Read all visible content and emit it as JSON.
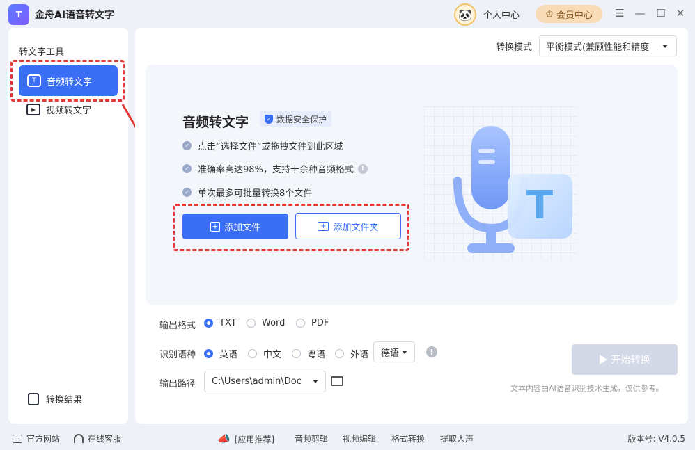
{
  "app": {
    "title": "金舟AI语音转文字",
    "logo_text": "T"
  },
  "header": {
    "personal_center": "个人中心",
    "vip_center": "会员中心",
    "controls": [
      "menu-icon",
      "minimize-icon",
      "maximize-icon",
      "close-icon"
    ]
  },
  "sidebar": {
    "heading": "转文字工具",
    "items": [
      {
        "label": "音频转文字",
        "active": true
      },
      {
        "label": "视频转文字",
        "active": false
      }
    ],
    "result": "转换结果"
  },
  "main": {
    "mode_label": "转换模式",
    "mode_value": "平衡模式(兼顾性能和精度",
    "dropzone": {
      "title": "音频转文字",
      "badge": "数据安全保护",
      "features": [
        "点击“选择文件”或拖拽文件到此区域",
        "准确率高达98%，支持十余种音频格式",
        "单次最多可批量转换8个文件"
      ],
      "add_file": "添加文件",
      "add_folder": "添加文件夹",
      "illustration_letter": "T"
    },
    "output_format": {
      "label": "输出格式",
      "options": [
        "TXT",
        "Word",
        "PDF"
      ],
      "selected": "TXT"
    },
    "language": {
      "label": "识别语种",
      "options": [
        "英语",
        "中文",
        "粤语",
        "外语"
      ],
      "selected": "英语",
      "foreign_value": "德语"
    },
    "output_path": {
      "label": "输出路径",
      "value": "C:\\Users\\admin\\Doc"
    },
    "start_button": "开始转换",
    "disclaimer": "文本内容由AI语音识别技术生成，仅供参考。"
  },
  "footer": {
    "official_site": "官方网站",
    "online_service": "在线客服",
    "recommend": "[应用推荐]",
    "links": [
      "音频剪辑",
      "视频编辑",
      "格式转换",
      "提取人声"
    ],
    "version": "版本号: V4.0.5"
  },
  "colors": {
    "accent": "#3a6ef5",
    "annotation": "#e53935",
    "vip": "#f8dcb7"
  }
}
